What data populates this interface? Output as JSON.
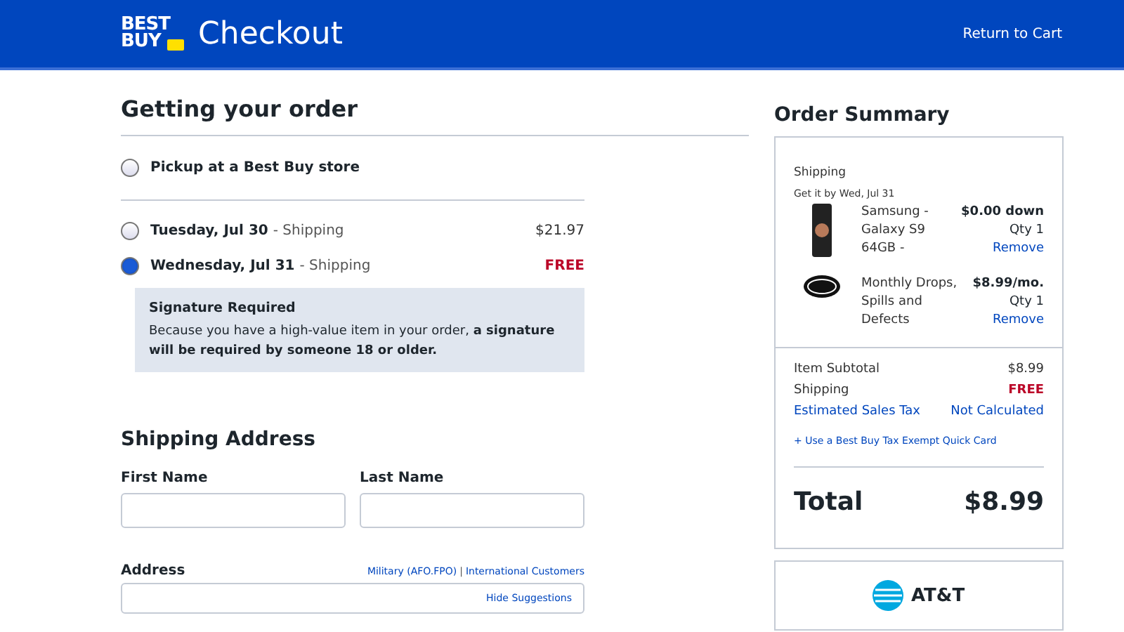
{
  "header": {
    "logo": [
      "BEST",
      "BUY"
    ],
    "title": "Checkout",
    "return_link": "Return to Cart"
  },
  "delivery": {
    "heading": "Getting your order",
    "pickup": {
      "label": "Pickup at a Best Buy store",
      "selected": false
    },
    "options": [
      {
        "date": "Tuesday, Jul 30",
        "method": "- Shipping",
        "price": "$21.97",
        "free": false,
        "selected": false
      },
      {
        "date": "Wednesday, Jul 31",
        "method": "- Shipping",
        "price": "FREE",
        "free": true,
        "selected": true
      }
    ],
    "notice": {
      "title": "Signature Required",
      "text": "Because you have a high-value item in your order, **a signature will be required by someone 18 or older.**"
    }
  },
  "address": {
    "heading": "Shipping Address",
    "fields": [
      {
        "label": "First Name"
      },
      {
        "label": "Last Name"
      }
    ],
    "address_label": "Address",
    "links": [
      "Military (AFO.FPO)",
      "International Customers"
    ],
    "separator": "|",
    "hide_link": "Hide Suggestions"
  },
  "summary": {
    "heading": "Order Summary",
    "section": "Shipping",
    "delivery_note": "Get it by Wed, Jul 31",
    "items": [
      {
        "kind": "phone",
        "name": "Samsung - Galaxy S9 64GB -",
        "price": "$0.00 down",
        "qty": "Qty 1",
        "remove": "Remove"
      },
      {
        "kind": "protection",
        "name": "Monthly Drops, Spills and Defects",
        "price": "$8.99/mo.",
        "qty": "Qty 1",
        "remove": "Remove"
      }
    ],
    "lines": [
      {
        "label": "Item Subtotal",
        "value": "$8.99",
        "kind": "plain"
      },
      {
        "label": "Shipping",
        "value": "FREE",
        "kind": "free"
      },
      {
        "label": "Estimated Sales Tax",
        "value": "Not Calculated",
        "kind": "link"
      }
    ],
    "tax_link": "+ Use a Best Buy Tax Exempt Quick Card",
    "total_label": "Total",
    "total": "$8.99"
  },
  "carrier": {
    "name": "AT&T"
  }
}
